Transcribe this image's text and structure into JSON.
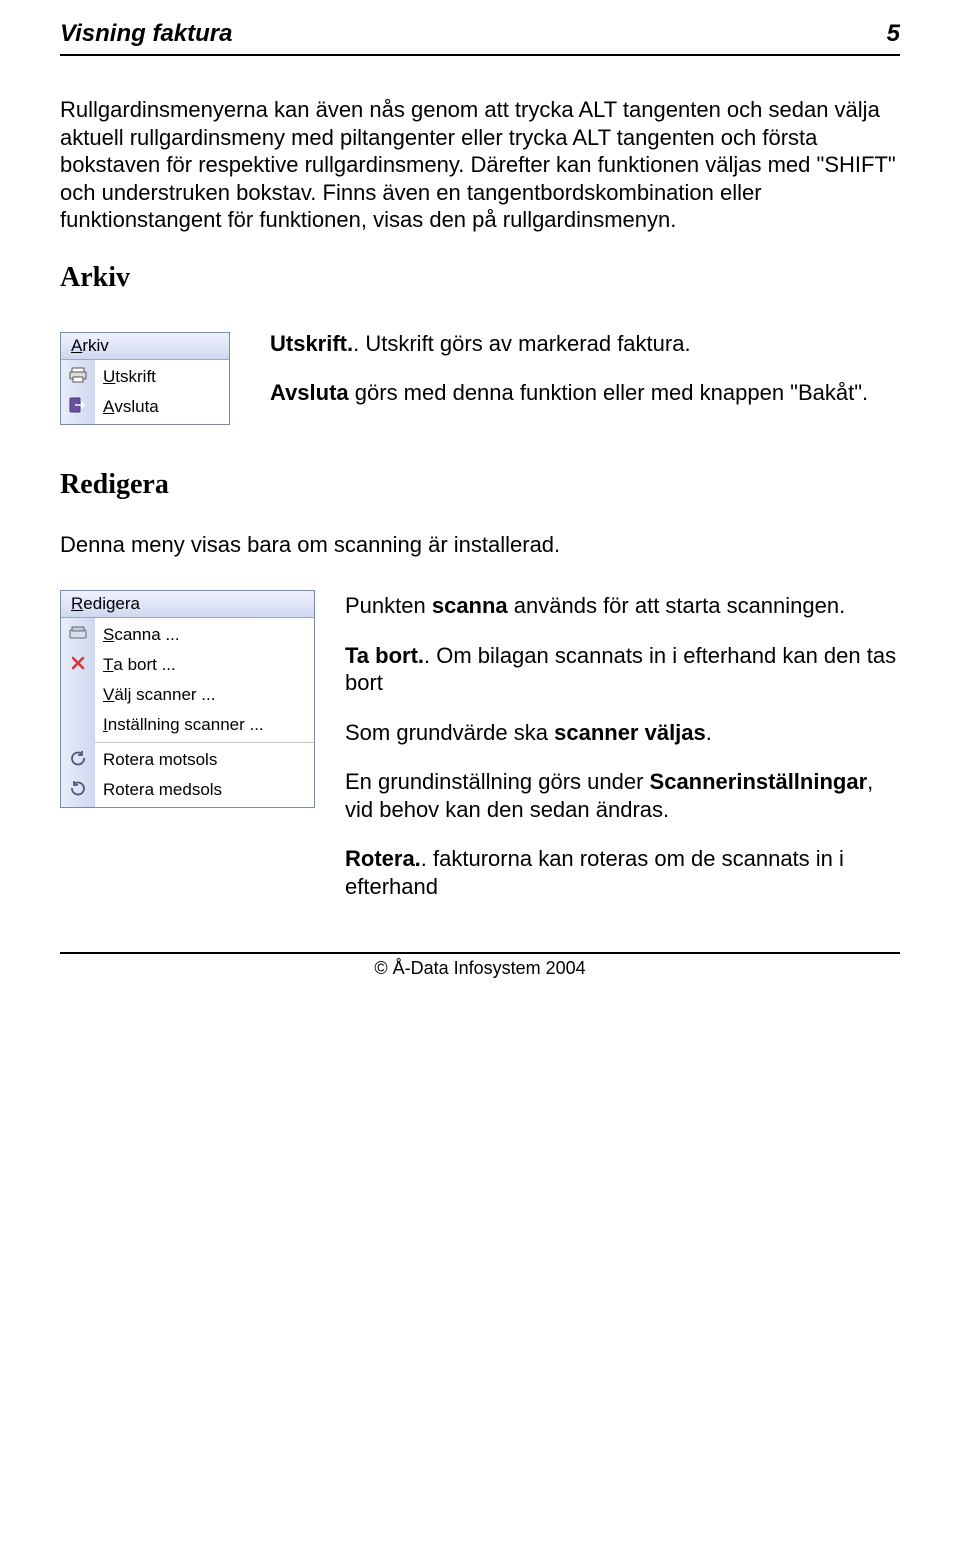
{
  "header": {
    "title": "Visning faktura",
    "page_num": "5"
  },
  "intro_para": "Rullgardinsmenyerna kan även nås genom att trycka ALT tangenten och sedan välja aktuell rullgardinsmeny med piltangenter eller trycka ALT tangenten och första bokstaven för respektive rullgardinsmeny. Därefter kan funktionen väljas med \"SHIFT\" och understruken bokstav. Finns även en tangentbordskombination eller funktionstangent för funktionen, visas den på rullgardinsmenyn.",
  "arkiv": {
    "heading": "Arkiv",
    "menu_title_pre": "A",
    "menu_title_rest": "rkiv",
    "items": [
      {
        "icon": "printer-icon",
        "ul": "U",
        "rest": "tskrift"
      },
      {
        "icon": "exit-icon",
        "ul": "A",
        "rest": "vsluta"
      }
    ],
    "desc": [
      {
        "bold": "Utskrift.",
        "plain": ". Utskrift görs av markerad faktura."
      },
      {
        "bold": "Avsluta",
        "plain": " görs med denna funktion eller med knappen \"Bakåt\"."
      }
    ]
  },
  "redigera": {
    "heading": "Redigera",
    "intro": "Denna meny visas bara om scanning är installerad.",
    "menu_title_pre": "R",
    "menu_title_rest": "edigera",
    "items": [
      {
        "icon": "scanner-icon",
        "ul": "S",
        "rest": "canna ..."
      },
      {
        "icon": "delete-icon",
        "ul": "T",
        "rest": "a bort ..."
      },
      {
        "icon": "",
        "ul": "V",
        "rest": "älj scanner ..."
      },
      {
        "icon": "",
        "ul": "I",
        "rest": "nställning scanner ..."
      },
      {
        "sep": true
      },
      {
        "icon": "rotate-ccw-icon",
        "ul": "",
        "rest": "Rotera motsols"
      },
      {
        "icon": "rotate-cw-icon",
        "ul": "",
        "rest": "Rotera medsols"
      }
    ],
    "desc": [
      {
        "plain_pre": "Punkten ",
        "bold": "scanna",
        "plain": " används för att starta scanningen."
      },
      {
        "bold": "Ta bort.",
        "plain": ". Om bilagan scannats in i efterhand kan den tas bort"
      },
      {
        "plain_pre": "Som grundvärde ska ",
        "bold": "scanner väljas",
        "plain": "."
      },
      {
        "plain_pre": "En grundinställning görs under ",
        "bold": "Scannerinställningar",
        "plain": ", vid behov kan den sedan ändras."
      },
      {
        "bold": "Rotera.",
        "plain": ". fakturorna kan roteras om de scannats in i efterhand"
      }
    ]
  },
  "footer": "© Å-Data Infosystem 2004"
}
